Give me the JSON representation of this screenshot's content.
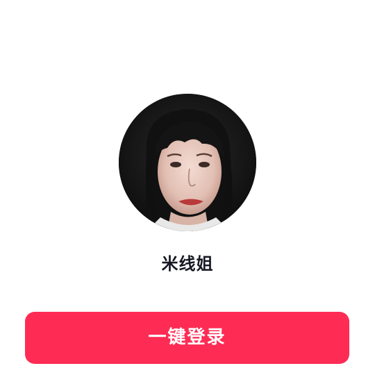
{
  "profile": {
    "username": "米线姐",
    "avatar_icon": "user-avatar-photo"
  },
  "actions": {
    "one_tap_login_label": "一键登录"
  },
  "colors": {
    "accent": "#fe2c55",
    "text_primary": "#161823",
    "background": "#ffffff"
  }
}
